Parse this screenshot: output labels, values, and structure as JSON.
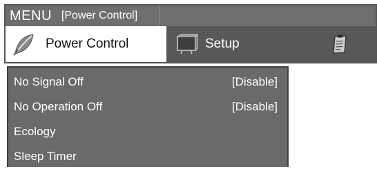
{
  "header": {
    "title": "MENU",
    "breadcrumb": "[Power Control]"
  },
  "tabs": [
    {
      "label": "Power Control",
      "icon": "leaf-icon",
      "active": true
    },
    {
      "label": "Setup",
      "icon": "setup-icon",
      "active": false
    },
    {
      "label": "",
      "icon": "clipboard-icon",
      "active": false
    }
  ],
  "menu_items": [
    {
      "label": "No Signal Off",
      "value": "[Disable]"
    },
    {
      "label": "No Operation Off",
      "value": "[Disable]"
    },
    {
      "label": "Ecology",
      "value": ""
    },
    {
      "label": "Sleep Timer",
      "value": ""
    }
  ],
  "colors": {
    "title_bar": "#6e6e6e",
    "inactive_tab": "#585858",
    "list_panel": "#6a6a6a",
    "active_tab": "#ffffff"
  }
}
